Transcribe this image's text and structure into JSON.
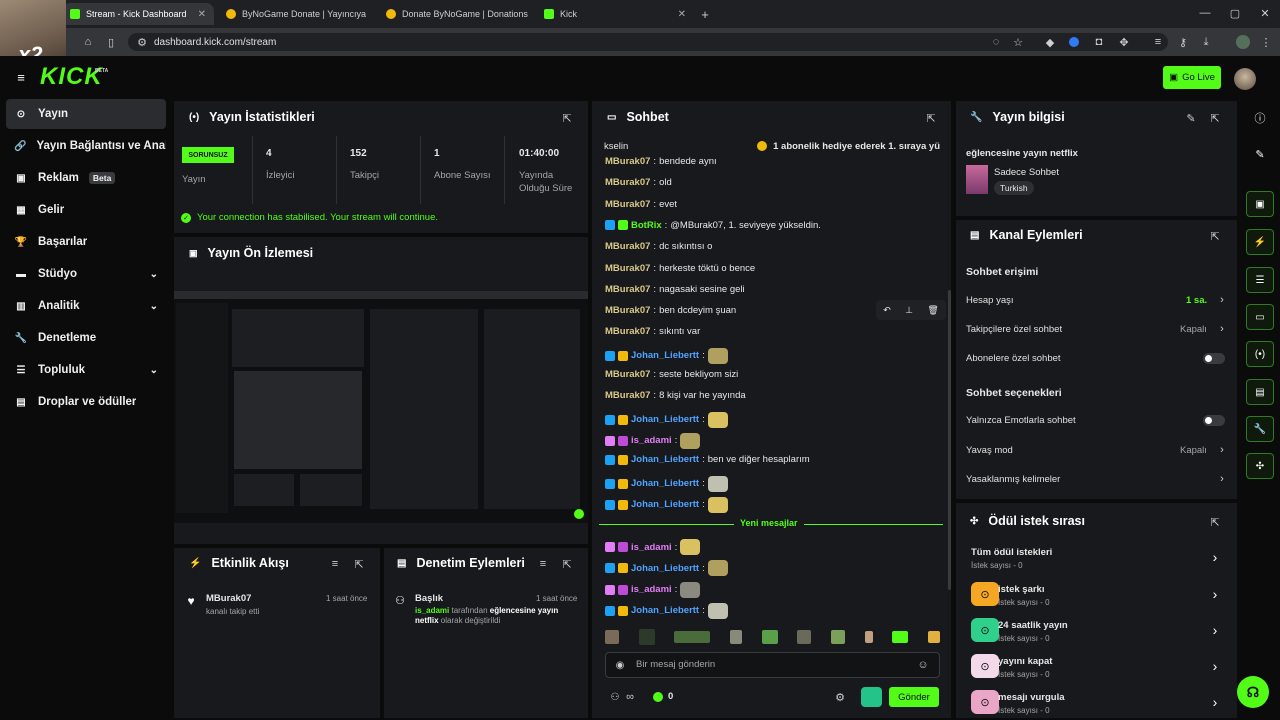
{
  "browser": {
    "tabs": [
      {
        "label": "Stream - Kick Dashboard",
        "color": "#53fc18"
      },
      {
        "label": "ByNoGame Donate | Yayıncıya",
        "color": "#f0b90b"
      },
      {
        "label": "Donate ByNoGame | Donations",
        "color": "#f0b90b"
      },
      {
        "label": "Kick",
        "color": "#53fc18"
      }
    ],
    "url": "dashboard.kick.com/stream"
  },
  "overlay": {
    "label": "x2"
  },
  "header": {
    "logo": "KICK",
    "logo_sup": "BETA",
    "go_live": "Go Live"
  },
  "sidebar": {
    "items": [
      {
        "label": "Yayın",
        "icon": "broadcast-icon",
        "glyph": "⊙"
      },
      {
        "label": "Yayın Bağlantısı ve Anahta",
        "icon": "link-icon",
        "glyph": "🔗"
      },
      {
        "label": "Reklam",
        "icon": "ad-icon",
        "glyph": "▣",
        "badge": "Beta"
      },
      {
        "label": "Gelir",
        "icon": "revenue-icon",
        "glyph": "▦"
      },
      {
        "label": "Başarılar",
        "icon": "trophy-icon",
        "glyph": "🏆"
      },
      {
        "label": "Stüdyo",
        "icon": "studio-icon",
        "glyph": "▬",
        "chevron": true
      },
      {
        "label": "Analitik",
        "icon": "analytics-icon",
        "glyph": "▥",
        "chevron": true
      },
      {
        "label": "Denetleme",
        "icon": "wrench-icon",
        "glyph": "🔧"
      },
      {
        "label": "Topluluk",
        "icon": "community-icon",
        "glyph": "☰",
        "chevron": true
      },
      {
        "label": "Droplar ve ödüller",
        "icon": "gift-icon",
        "glyph": "▤"
      }
    ]
  },
  "stats": {
    "title": "Yayın İstatistikleri",
    "status_badge": "SORUNSUZ",
    "status_label": "Yayın",
    "items": [
      {
        "value": "4",
        "label": "İzleyici"
      },
      {
        "value": "152",
        "label": "Takipçi"
      },
      {
        "value": "1",
        "label": "Abone Sayısı"
      },
      {
        "value": "01:40:00",
        "label": "Yayında Olduğu Süre"
      }
    ],
    "notice": "Your connection has stabilised. Your stream will continue."
  },
  "preview": {
    "title": "Yayın Ön İzlemesi"
  },
  "activity": {
    "title": "Etkinlik Akışı",
    "item_user": "MBurak07",
    "item_text": "kanalı takip etti",
    "item_time": "1 saat önce"
  },
  "moderation": {
    "title": "Denetim Eylemleri",
    "item_title": "Başlık",
    "item_user": "is_adami",
    "item_text1": "tarafından",
    "item_highlight": "eğlencesine yayın netflix",
    "item_text2": "olarak değiştirildi",
    "item_time": "1 saat önce"
  },
  "chat": {
    "title": "Sohbet",
    "pinned_user": "kselin",
    "pinned_text": "1 abonelik hediye ederek 1. sıraya yü",
    "lines": [
      {
        "user": "MBurak07",
        "text": "bendede aynı",
        "color": "gold"
      },
      {
        "user": "MBurak07",
        "text": "old",
        "color": "gold"
      },
      {
        "user": "MBurak07",
        "text": "evet",
        "color": "gold"
      },
      {
        "user": "BotRix",
        "text": "@MBurak07, 1. seviyeye yükseldin.",
        "color": "green"
      },
      {
        "user": "MBurak07",
        "text": "dc sıkıntısı o",
        "color": "gold"
      },
      {
        "user": "MBurak07",
        "text": "herkeste töktü o bence",
        "color": "gold"
      },
      {
        "user": "MBurak07",
        "text": "nagasaki sesine geli",
        "color": "gold"
      },
      {
        "user": "MBurak07",
        "text": "ben dcdeyim şuan",
        "color": "gold"
      },
      {
        "user": "MBurak07",
        "text": "sıkıntı var",
        "color": "gold"
      },
      {
        "user": "Johan_Liebertt",
        "text": "",
        "color": "blue"
      },
      {
        "user": "MBurak07",
        "text": "seste bekliyom sizi",
        "color": "gold"
      },
      {
        "user": "MBurak07",
        "text": "8 kişi var he yayında",
        "color": "gold"
      },
      {
        "user": "Johan_Liebertt",
        "text": "",
        "color": "blue"
      },
      {
        "user": "is_adami",
        "text": "",
        "color": "pink"
      },
      {
        "user": "Johan_Liebertt",
        "text": "ben ve diğer hesaplarım",
        "color": "blue"
      },
      {
        "user": "Johan_Liebertt",
        "text": "",
        "color": "blue"
      },
      {
        "user": "Johan_Liebertt",
        "text": "",
        "color": "blue"
      }
    ],
    "new_messages": "Yeni mesajlar",
    "new_lines": [
      {
        "user": "is_adami",
        "text": "",
        "color": "pink"
      },
      {
        "user": "Johan_Liebertt",
        "text": "",
        "color": "blue"
      },
      {
        "user": "is_adami",
        "text": "",
        "color": "pink"
      },
      {
        "user": "Johan_Liebertt",
        "text": "",
        "color": "blue"
      }
    ],
    "input_placeholder": "Bir mesaj gönderin",
    "points": "0",
    "send": "Gönder"
  },
  "info": {
    "title": "Yayın bilgisi",
    "stream_title": "eğlencesine yayın netflix",
    "category": "Sadece Sohbet",
    "tag": "Turkish"
  },
  "channel": {
    "title": "Kanal Eylemleri",
    "access_heading": "Sohbet erişimi",
    "account_age": "Hesap yaşı",
    "account_age_value": "1 sa.",
    "followers_only": "Takipçilere özel sohbet",
    "followers_only_value": "Kapalı",
    "subs_only": "Abonelere özel sohbet",
    "options_heading": "Sohbet seçenekleri",
    "emotes_only": "Yalnızca Emotlarla sohbet",
    "slow_mode": "Yavaş mod",
    "slow_mode_value": "Kapalı",
    "banned_words": "Yasaklanmış kelimeler"
  },
  "rewards": {
    "title": "Ödül istek sırası",
    "items": [
      {
        "label": "Tüm ödül istekleri",
        "sub": "İstek sayısı - 0"
      },
      {
        "label": "istek şarkı",
        "sub": "İstek sayısı - 0",
        "color": "#f5a623"
      },
      {
        "label": "24 saatlik yayın",
        "sub": "İstek sayısı - 0",
        "color": "#2fd18a"
      },
      {
        "label": "yayını kapat",
        "sub": "İstek sayısı - 0",
        "color": "#f3d9e9"
      },
      {
        "label": "mesajı vurgula",
        "sub": "İstek sayısı - 0",
        "color": "#e9a6c6"
      }
    ]
  }
}
